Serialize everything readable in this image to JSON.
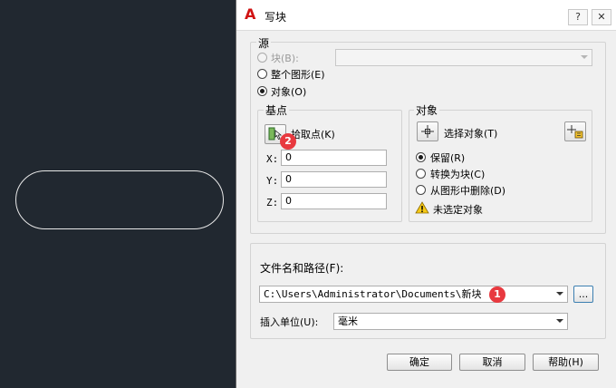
{
  "dialog": {
    "title": "写块",
    "help_btn": "?",
    "close_btn": "✕"
  },
  "source": {
    "label": "源",
    "block": "块(B):",
    "entire_drawing": "整个图形(E)",
    "objects": "对象(O)",
    "selected": "objects"
  },
  "base_point": {
    "label": "基点",
    "pick_point": "拾取点(K)",
    "x_label": "X:",
    "y_label": "Y:",
    "z_label": "Z:",
    "x": "0",
    "y": "0",
    "z": "0"
  },
  "objects_group": {
    "label": "对象",
    "select_objects": "选择对象(T)",
    "retain": "保留(R)",
    "convert_to_block": "转换为块(C)",
    "delete_from_drawing": "从图形中删除(D)",
    "selected": "retain",
    "warning": "未选定对象"
  },
  "destination": {
    "file_label": "文件名和路径(F):",
    "file_path": "C:\\Users\\Administrator\\Documents\\新块",
    "browse_label": "...",
    "units_label": "插入单位(U):",
    "units_value": "毫米"
  },
  "buttons": {
    "ok": "确定",
    "cancel": "取消",
    "help": "帮助(H)"
  },
  "callouts": {
    "one": "1",
    "two": "2"
  },
  "colors": {
    "background": "#212830",
    "dialog": "#f0f0f0",
    "badge": "#e8393f",
    "logo": "#d01212"
  }
}
